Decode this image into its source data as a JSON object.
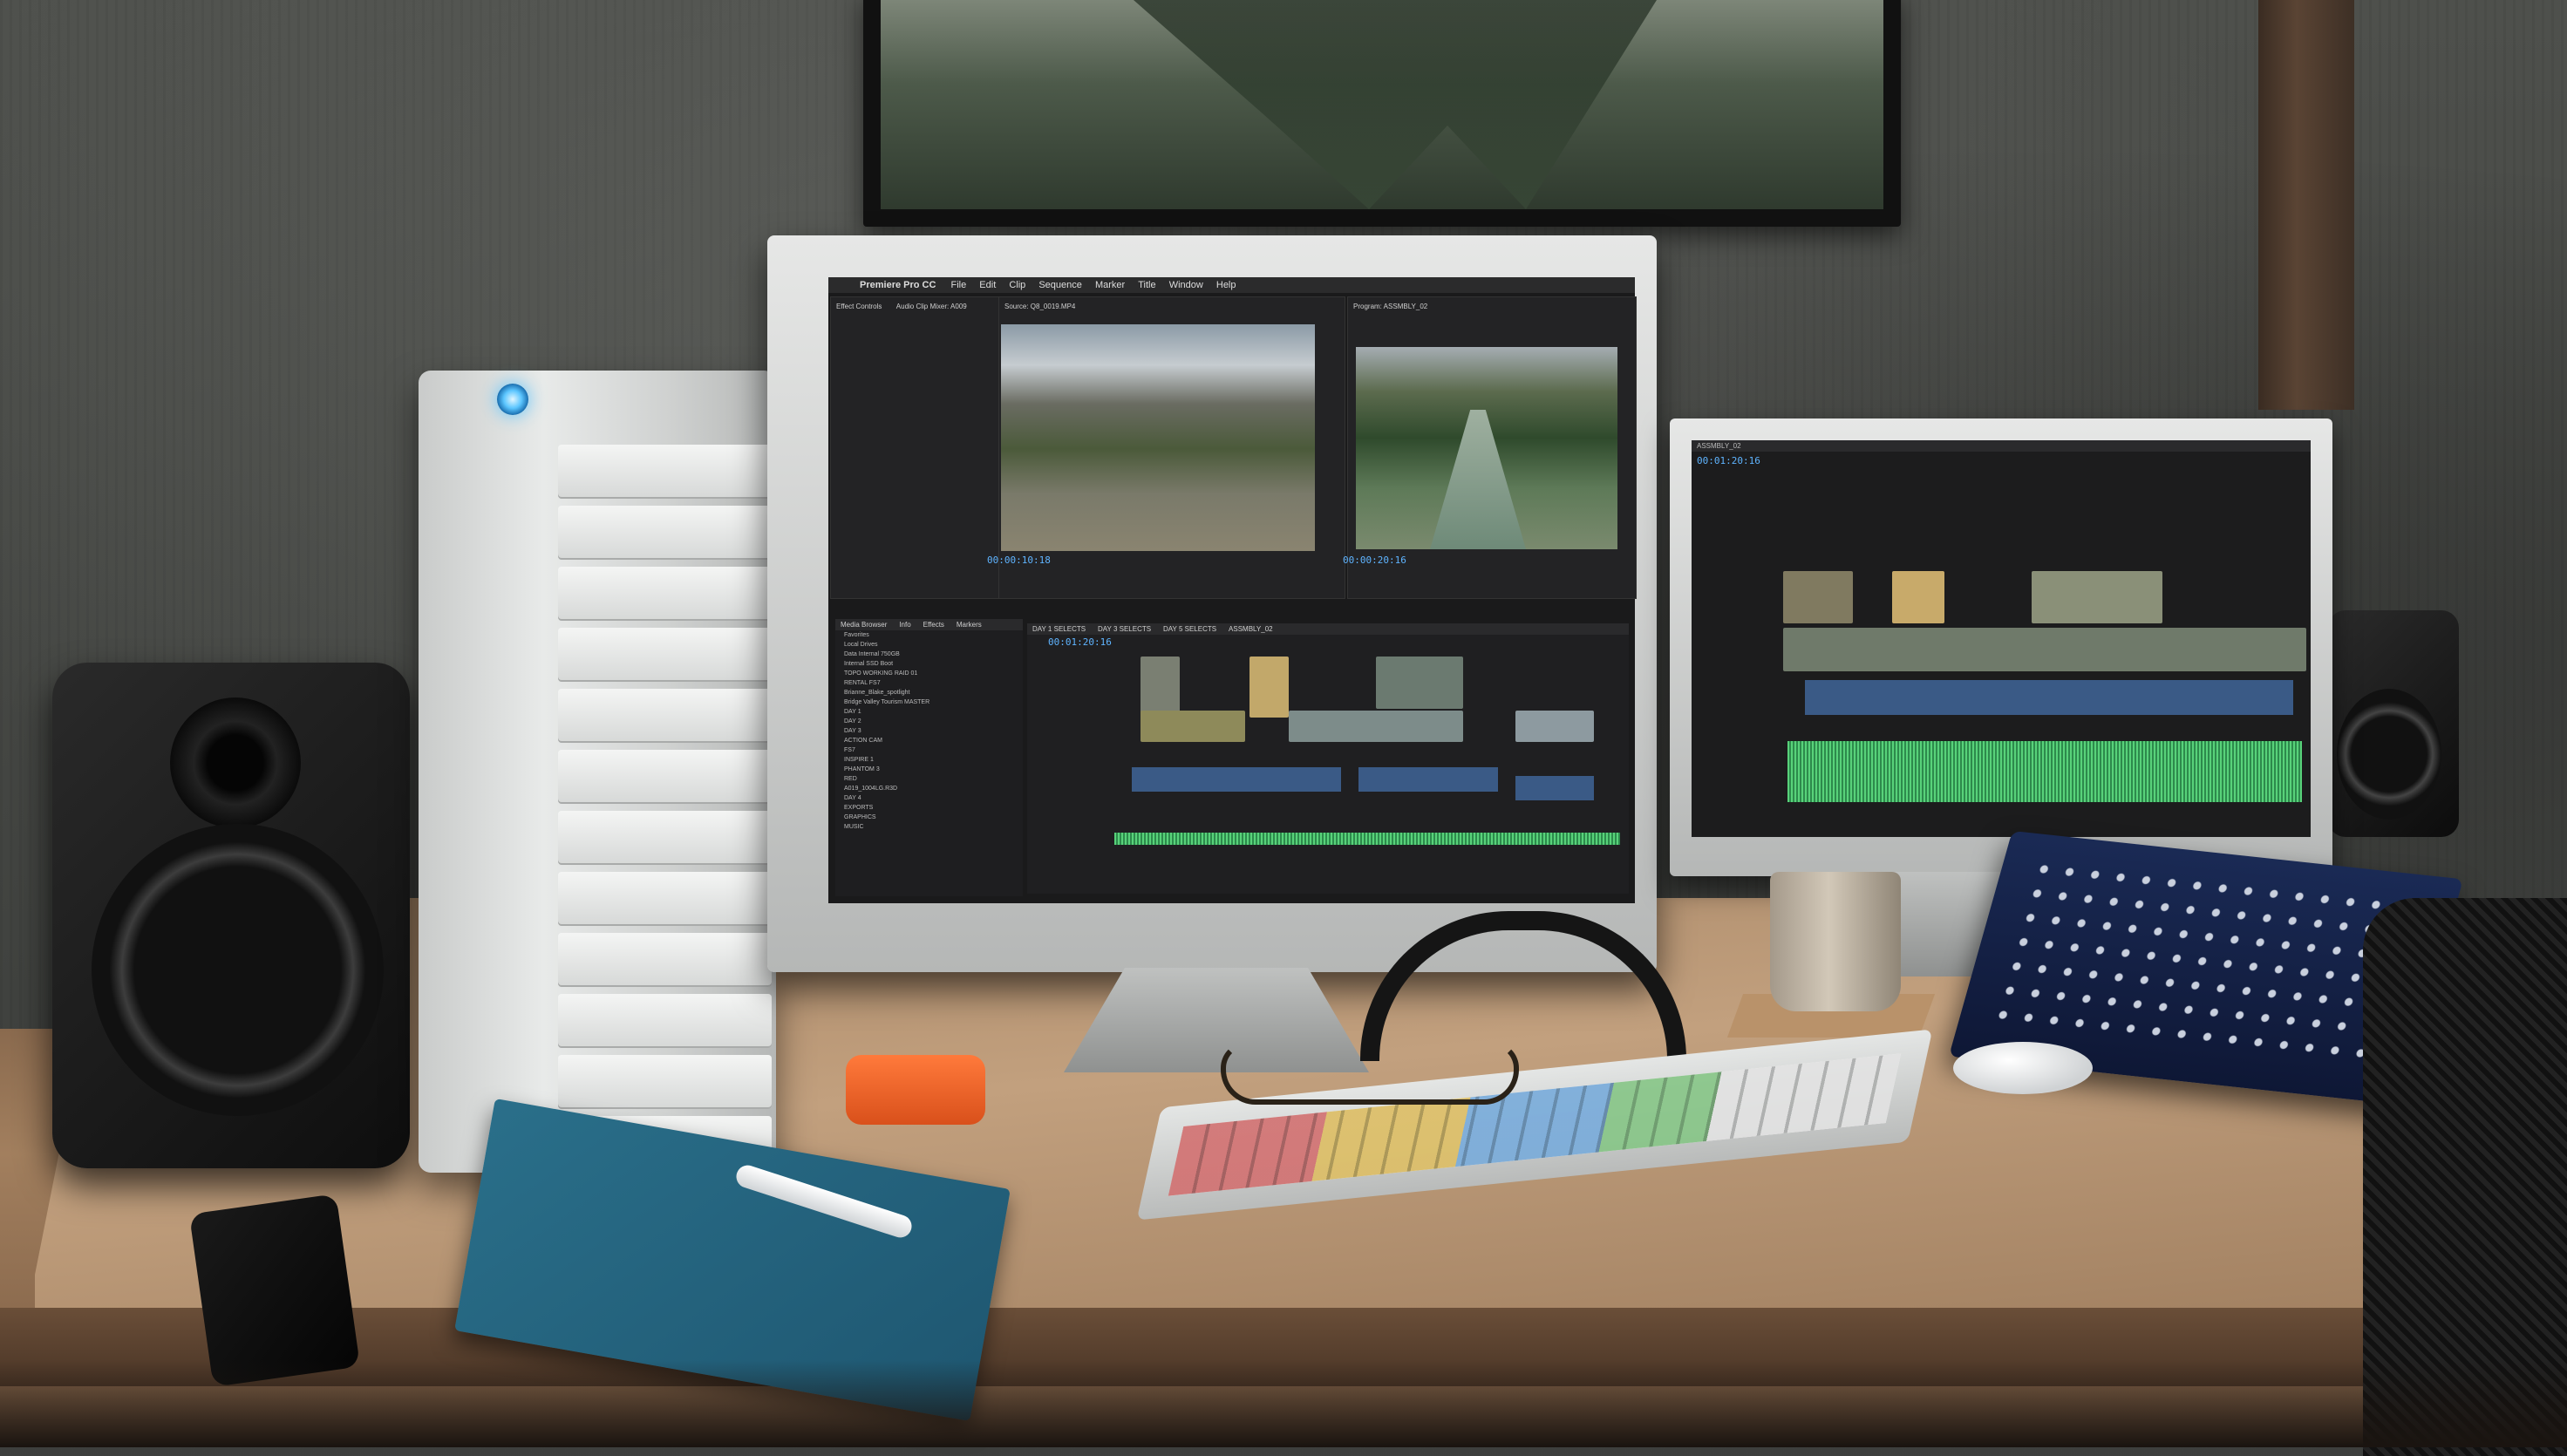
{
  "scene": "photo",
  "premiere": {
    "app_name": "Premiere Pro CC",
    "menu": [
      "File",
      "Edit",
      "Clip",
      "Sequence",
      "Marker",
      "Title",
      "Window",
      "Help"
    ],
    "panels": {
      "effect_controls": "Effect Controls",
      "audio_mixer": "Audio Clip Mixer: A009",
      "source": "Source: Q8_0019.MP4",
      "program": "Program: ASSMBLY_02",
      "media_browser": "Media Browser",
      "info": "Info",
      "effects": "Effects",
      "markers": "Markers"
    },
    "source_timecode": "00:00:10:18",
    "program_timecode": "00:00:20:16",
    "timeline_timecode": "00:01:20:16",
    "timeline_tabs": [
      "DAY 1 SELECTS",
      "DAY 3 SELECTS",
      "DAY 5 SELECTS",
      "ASSMBLY_02"
    ],
    "bin_items": [
      "Favorites",
      "Local Drives",
      "Data Internal 750GB",
      "Internal SSD Boot",
      "TOPO WORKING RAID 01",
      "RENTAL FS7",
      "Brianne_Blake_spotlight",
      "Bridge Valley Tourism MASTER",
      "DAY 1",
      "DAY 2",
      "DAY 3",
      "ACTION CAM",
      "FS7",
      "INSPIRE 1",
      "PHANTOM 3",
      "RED",
      "A019_1004LG.R3D",
      "DAY 4",
      "EXPORTS",
      "GRAPHICS",
      "MUSIC"
    ]
  },
  "monitor2": {
    "timecode": "00:01:20:16",
    "tab": "ASSMBLY_02"
  },
  "colors": {
    "raid_led": "#5cc6ff",
    "ssd": "#e8622a",
    "notebook": "#25627c",
    "waveform": "#58d27a"
  }
}
